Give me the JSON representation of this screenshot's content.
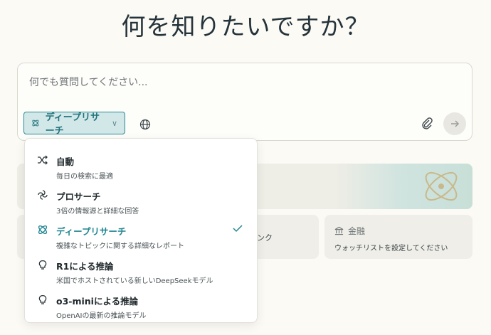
{
  "heading": "何を知りたいですか？",
  "search": {
    "placeholder": "何でも質問してください...",
    "mode_label": "ディープリサーチ",
    "accent": "#20727b"
  },
  "cards": {
    "link_text": "リンク",
    "finance_title": "金融",
    "finance_desc": "ウォッチリストを設定してください"
  },
  "menu": {
    "items": [
      {
        "label": "自動",
        "desc": "毎日の検索に最適",
        "icon": "shuffle-icon",
        "selected": false
      },
      {
        "label": "プロサーチ",
        "desc": "3倍の情報源と詳細な回答",
        "icon": "pro-search-icon",
        "selected": false
      },
      {
        "label": "ディープリサーチ",
        "desc": "複雑なトピックに関する詳細なレポート",
        "icon": "atom-icon",
        "selected": true
      },
      {
        "label": "R1による推論",
        "desc": "米国でホストされている新しいDeepSeekモデル",
        "icon": "lightbulb-icon",
        "selected": false
      },
      {
        "label": "o3-miniによる推論",
        "desc": "OpenAIの最新の推論モデル",
        "icon": "lightbulb-icon",
        "selected": false
      }
    ]
  }
}
